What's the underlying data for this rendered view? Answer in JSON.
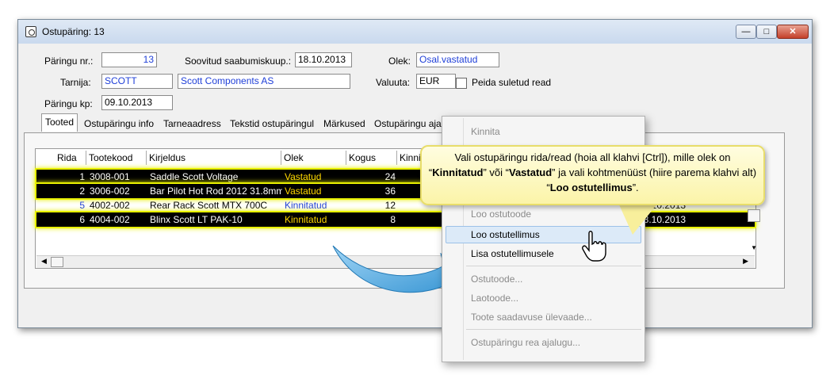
{
  "window": {
    "title": "Ostupäring: 13"
  },
  "form": {
    "req_nr_label": "Päringu nr.:",
    "req_nr_value": "13",
    "arrival_label": "Soovitud saabumiskuup.:",
    "arrival_value": "18.10.2013",
    "status_label": "Olek:",
    "status_value": "Osal.vastatud",
    "supplier_label": "Tarnija:",
    "supplier_code": "SCOTT",
    "supplier_name": "Scott Components AS",
    "currency_label": "Valuuta:",
    "currency_value": "EUR",
    "hide_closed_label": "Peida suletud read",
    "date_label": "Päringu kp:",
    "date_value": "09.10.2013"
  },
  "tabs": [
    "Tooted",
    "Ostupäringu info",
    "Tarneaadress",
    "Tekstid ostupäringul",
    "Märkused",
    "Ostupäringu ajal"
  ],
  "grid": {
    "columns": [
      "Rida",
      "Tootekood",
      "Kirjeldus",
      "Olek",
      "Kogus",
      "Kinnit"
    ],
    "rows": [
      {
        "rida": "1",
        "code": "3008-001",
        "desc": "Saddle Scott Voltage",
        "status": "Vastatud",
        "qty": "24",
        "date": "",
        "selected": true
      },
      {
        "rida": "2",
        "code": "3006-002",
        "desc": "Bar Pilot Hot Rod 2012 31.8mm B",
        "status": "Vastatud",
        "qty": "36",
        "date": "",
        "selected": true
      },
      {
        "rida": "5",
        "code": "4002-002",
        "desc": "Rear Rack Scott MTX 700C",
        "status": "Kinnitatud",
        "qty": "12",
        "date": "18.10.2013",
        "selected": false
      },
      {
        "rida": "6",
        "code": "4004-002",
        "desc": "Blinx Scott LT PAK-10",
        "status": "Kinnitatud",
        "qty": "8",
        "date": "18.10.2013",
        "selected": true
      }
    ]
  },
  "context_menu": {
    "items": [
      {
        "label": "Kinnita",
        "enabled": false
      },
      {
        "label": "Loo ostutoode",
        "enabled": false
      },
      {
        "label": "Loo ostutellimus",
        "enabled": true
      },
      {
        "label": "Lisa ostutellimusele",
        "enabled": true
      },
      {
        "label": "Ostutoode...",
        "enabled": false
      },
      {
        "label": "Laotoode...",
        "enabled": false
      },
      {
        "label": "Toote saadavuse ülevaade...",
        "enabled": false
      },
      {
        "label": "Ostupäringu rea ajalugu...",
        "enabled": false
      }
    ]
  },
  "tooltip": {
    "p1": "Vali ostupäringu rida/read (hoia all klahvi [Ctrl]), mille olek on “",
    "b1": "Kinnitatud",
    "p2": "” või “",
    "b2": "Vastatud",
    "p3": "”  ja vali kohtmenüüst (hiire parema klahvi alt) “",
    "b3": "Loo ostutellimus",
    "p4": "”."
  },
  "colors": {
    "selected_row_bg": "#000000",
    "selected_row_text": "#ffffff",
    "status_yellow": "#ffd700",
    "selection_glow": "#e8f000",
    "link_blue": "#1f3fd8",
    "arrow_blue": "#3aa0dc"
  }
}
